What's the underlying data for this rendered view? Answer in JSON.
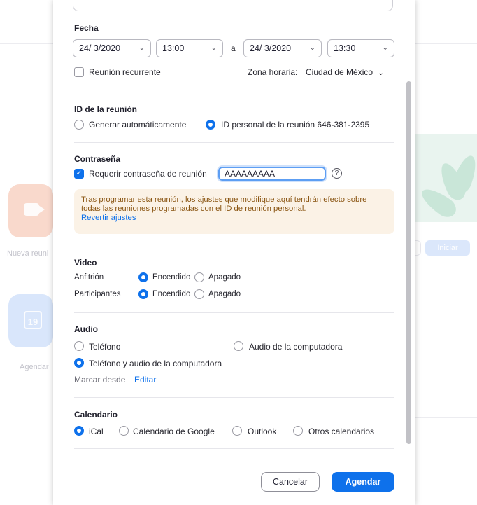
{
  "background": {
    "new_meeting_label": "Nueva reuni",
    "schedule_label": "Agendar",
    "calendar_day": "19",
    "start_button": "Iniciar"
  },
  "fecha": {
    "heading": "Fecha",
    "start_date": "24/ 3/2020",
    "start_time": "13:00",
    "separator": "a",
    "end_date": "24/ 3/2020",
    "end_time": "13:30",
    "recurring_label": "Reunión recurrente",
    "recurring_checked": false,
    "timezone_label": "Zona horaria:",
    "timezone_value": "Ciudad de México"
  },
  "meeting_id": {
    "heading": "ID de la reunión",
    "auto_label": "Generar automáticamente",
    "personal_label": "ID personal de la reunión 646-381-2395",
    "selected": "personal"
  },
  "password": {
    "heading": "Contraseña",
    "require_label": "Requerir contraseña de reunión",
    "require_checked": true,
    "value": "AAAAAAAAA",
    "help_glyph": "?",
    "warning_text": "Tras programar esta reunión, los ajustes que modifique aquí tendrán efecto sobre todas las reuniones programadas con el ID de reunión personal.",
    "revert_link": "Revertir ajustes"
  },
  "video": {
    "heading": "Video",
    "host_label": "Anfitrión",
    "participants_label": "Participantes",
    "on_label": "Encendido",
    "off_label": "Apagado",
    "host_state": "on",
    "participants_state": "on"
  },
  "audio": {
    "heading": "Audio",
    "phone_label": "Teléfono",
    "computer_label": "Audio de la computadora",
    "both_label": "Teléfono y audio de la computadora",
    "selected": "both",
    "dial_from_label": "Marcar desde",
    "edit_link": "Editar"
  },
  "calendar": {
    "heading": "Calendario",
    "options": [
      "iCal",
      "Calendario de Google",
      "Outlook",
      "Otros calendarios"
    ],
    "selected": "iCal"
  },
  "footer": {
    "cancel_label": "Cancelar",
    "schedule_label": "Agendar"
  },
  "colors": {
    "accent": "#0e71eb",
    "warning_bg": "#fbf2e6",
    "warning_text": "#8a5512"
  }
}
